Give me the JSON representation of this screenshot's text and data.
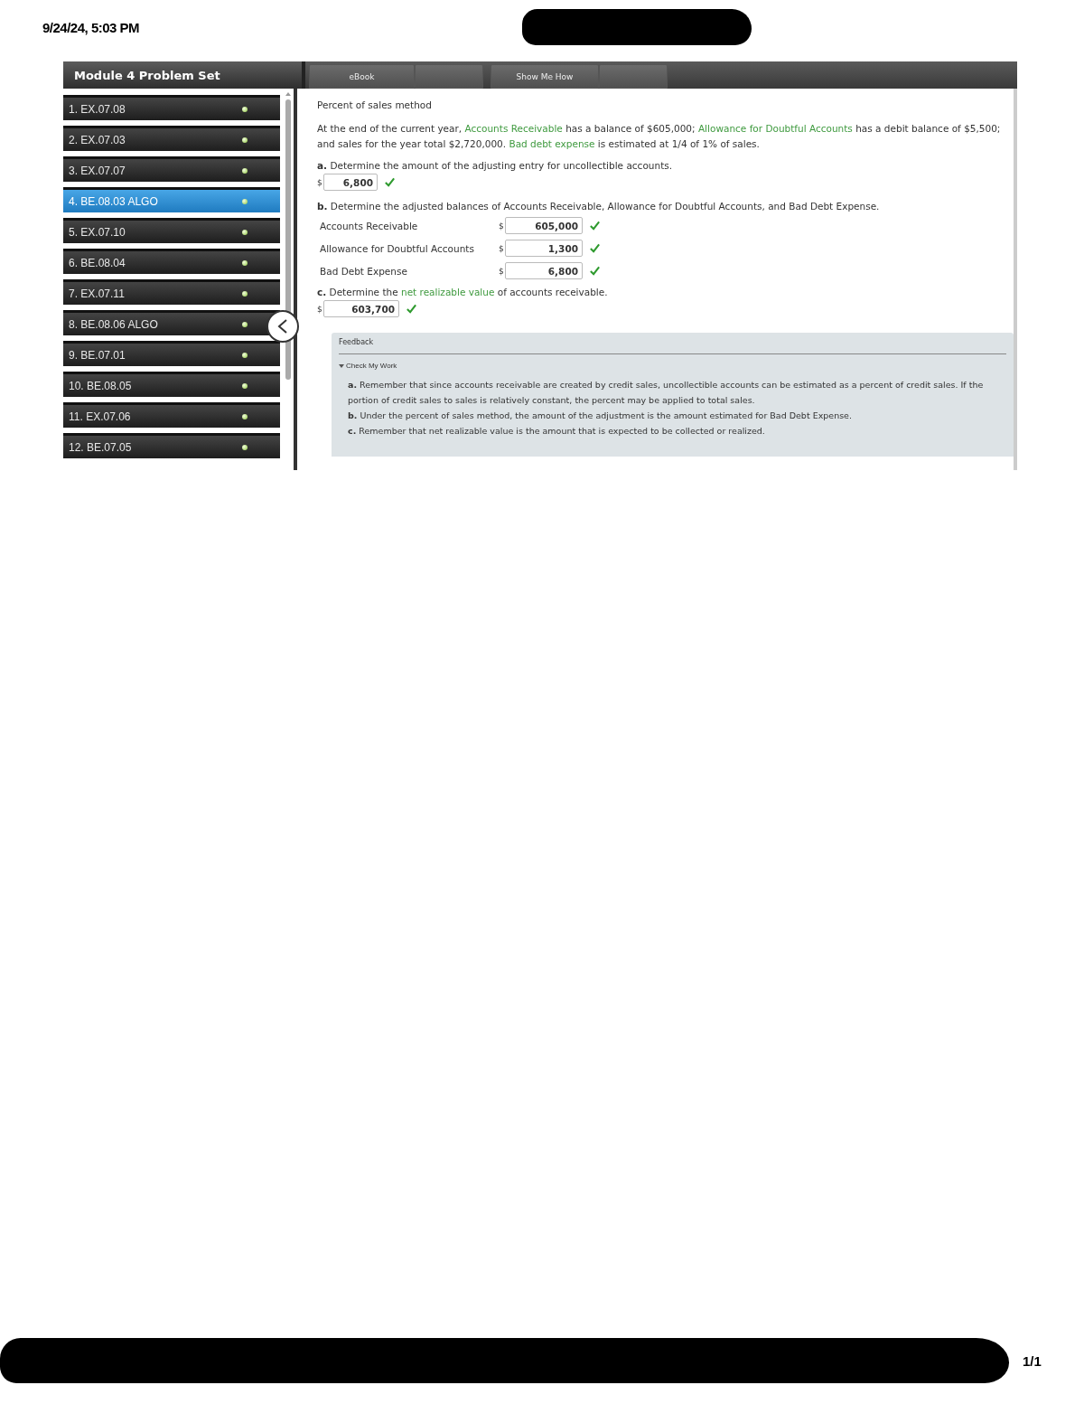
{
  "header": {
    "timestamp": "9/24/24, 5:03 PM"
  },
  "sidebar": {
    "title": "Module 4 Problem Set",
    "items": [
      {
        "label": "1. EX.07.08",
        "selected": false
      },
      {
        "label": "2. EX.07.03",
        "selected": false
      },
      {
        "label": "3. EX.07.07",
        "selected": false
      },
      {
        "label": "4. BE.08.03 ALGO",
        "selected": true
      },
      {
        "label": "5. EX.07.10",
        "selected": false
      },
      {
        "label": "6. BE.08.04",
        "selected": false
      },
      {
        "label": "7. EX.07.11",
        "selected": false
      },
      {
        "label": "8. BE.08.06 ALGO",
        "selected": false
      },
      {
        "label": "9. BE.07.01",
        "selected": false
      },
      {
        "label": "10. BE.08.05",
        "selected": false
      },
      {
        "label": "11. EX.07.06",
        "selected": false
      },
      {
        "label": "12. BE.07.05",
        "selected": false
      }
    ]
  },
  "toolbar": {
    "buttons": [
      "eBook",
      "Show Me How"
    ]
  },
  "problem": {
    "title": "Percent of sales method",
    "intro": [
      {
        "kind": "text",
        "text": "At the end of the current year, "
      },
      {
        "kind": "link",
        "text": "Accounts Receivable"
      },
      {
        "kind": "text",
        "text": " has a balance of $605,000; "
      },
      {
        "kind": "link",
        "text": "Allowance for Doubtful Accounts"
      },
      {
        "kind": "text",
        "text": " has a debit balance of $5,500; and sales for the year total $2,720,000. "
      },
      {
        "kind": "link",
        "text": "Bad debt expense"
      },
      {
        "kind": "text",
        "text": " is estimated at 1/4 of 1% of sales."
      }
    ],
    "part_a": {
      "prompt": [
        {
          "kind": "text",
          "text": "**a.** Determine the amount of the adjusting entry for uncollectible accounts."
        }
      ],
      "currency": "$",
      "answer": "6,800",
      "correct": true
    },
    "part_b": {
      "prompt": [
        {
          "kind": "text",
          "text": "**b.** Determine the adjusted balances of Accounts Receivable, Allowance for Doubtful Accounts, and Bad Debt Expense."
        }
      ],
      "rows": [
        {
          "label": "Accounts Receivable",
          "currency": "$",
          "answer": "605,000",
          "correct": true
        },
        {
          "label": "Allowance for Doubtful Accounts",
          "currency": "$",
          "answer": "1,300",
          "correct": true
        },
        {
          "label": "Bad Debt Expense",
          "currency": "$",
          "answer": "6,800",
          "correct": true
        }
      ]
    },
    "part_c": {
      "prompt": [
        {
          "kind": "text",
          "text": "**c.** Determine the "
        },
        {
          "kind": "link",
          "text": "net realizable value"
        },
        {
          "kind": "text",
          "text": " of accounts receivable."
        }
      ],
      "currency": "$",
      "answer": "603,700",
      "correct": true
    }
  },
  "feedback": {
    "title": "Feedback",
    "section": {
      "label": "Check My Work",
      "expanded": true
    },
    "lines": [
      "**a.** Remember that since accounts receivable are created by credit sales, uncollectible accounts can be estimated as a percent of credit sales. If the portion of credit sales to sales is relatively constant, the percent may be applied to total sales.",
      "**b.** Under the percent of sales method, the amount of the adjustment is the amount estimated for Bad Debt Expense.",
      "**c.** Remember that net realizable value is the amount that is expected to be collected or realized."
    ]
  },
  "footer": {
    "page": "1/1"
  }
}
